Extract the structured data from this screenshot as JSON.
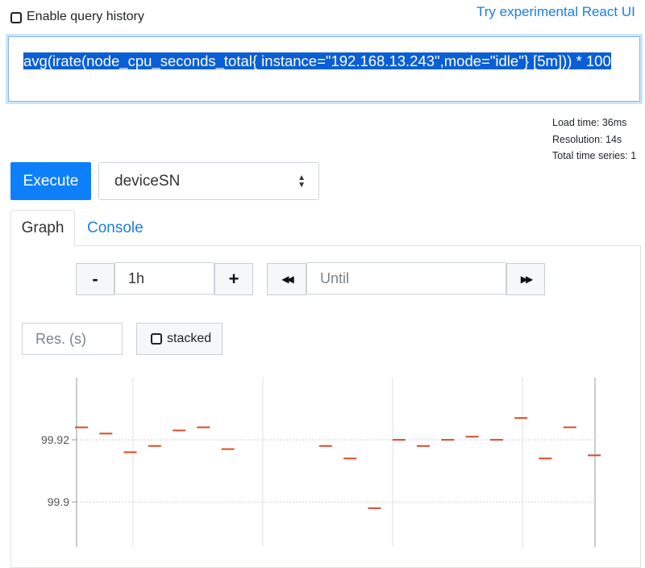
{
  "header": {
    "query_history_label": "Enable query history",
    "react_link": "Try experimental React UI"
  },
  "expression": {
    "text": "avg(irate(node_cpu_seconds_total{ instance=\"192.168.13.243\",mode=\"idle\"} [5m])) * 100"
  },
  "stats": {
    "load_time": "Load time: 36ms",
    "resolution": "Resolution: 14s",
    "total_series": "Total time series: 1"
  },
  "controls": {
    "execute_label": "Execute",
    "metric_select_value": "deviceSN"
  },
  "tabs": {
    "graph": "Graph",
    "console": "Console"
  },
  "range": {
    "minus_label": "-",
    "plus_label": "+",
    "duration_value": "1h",
    "until_placeholder": "Until",
    "back_label": "◀◀",
    "forward_label": "▶▶",
    "res_placeholder": "Res. (s)",
    "stacked_label": "stacked"
  },
  "colors": {
    "accent": "#0d7ffb",
    "series": "#d94a2a"
  },
  "chart_data": {
    "type": "scatter",
    "yticks": [
      "99.92",
      "99.9"
    ],
    "ylim": [
      99.885,
      99.94
    ],
    "series": [
      {
        "values": [
          99.924,
          99.922,
          99.916,
          99.918,
          99.923,
          99.924,
          99.917,
          null,
          null,
          null,
          99.918,
          99.914,
          99.898,
          99.92,
          99.918,
          99.92,
          99.921,
          99.92,
          99.927,
          99.914,
          99.924,
          99.915
        ]
      }
    ],
    "grid": true
  }
}
